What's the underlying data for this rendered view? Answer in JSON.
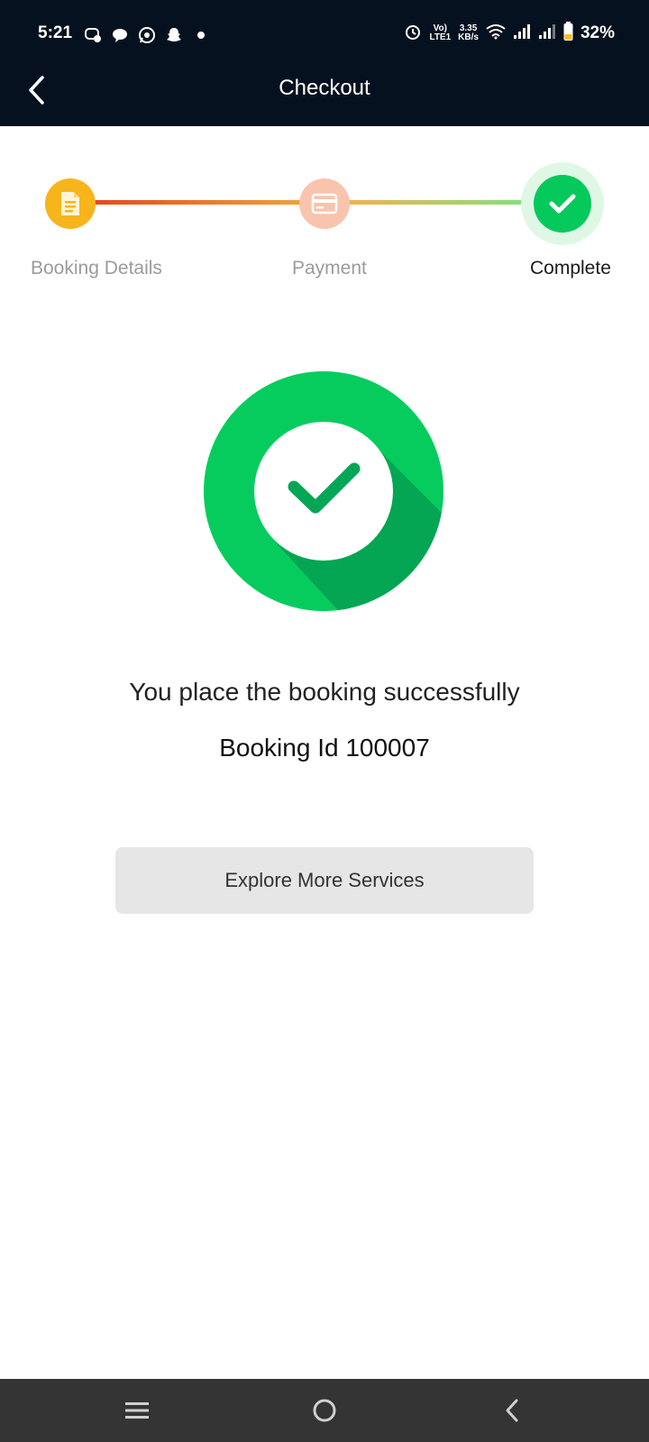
{
  "status_bar": {
    "time": "5:21",
    "network_label_top": "Vo)",
    "network_label_bottom": "LTE1",
    "speed_value": "3.35",
    "speed_unit": "KB/s",
    "battery": "32%"
  },
  "header": {
    "title": "Checkout",
    "background_color": "#06111f"
  },
  "stepper": {
    "steps": [
      {
        "label": "Booking Details",
        "state": "done",
        "color": "#f8b41b",
        "icon": "document-icon"
      },
      {
        "label": "Payment",
        "state": "done",
        "color": "#f9c4ad",
        "icon": "card-icon"
      },
      {
        "label": "Complete",
        "state": "current",
        "color": "#06c95b",
        "icon": "check-icon"
      }
    ]
  },
  "success": {
    "message": "You place the booking successfully",
    "booking_id": "Booking Id 100007",
    "accent_color": "#06c95b"
  },
  "actions": {
    "explore_label": "Explore More Services"
  },
  "nav_bar": {
    "items": [
      "menu-icon",
      "home-icon",
      "back-icon"
    ]
  }
}
